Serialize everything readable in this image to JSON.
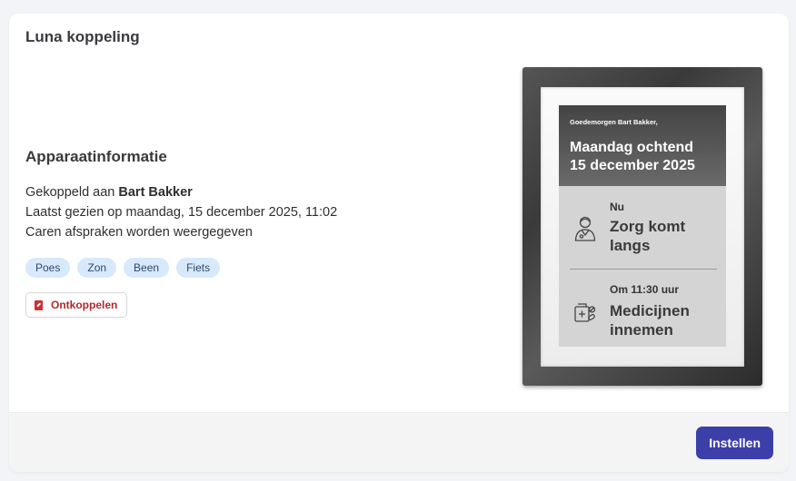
{
  "card": {
    "title": "Luna koppeling"
  },
  "info": {
    "section_title": "Apparaatinformatie",
    "linked_prefix": "Gekoppeld aan ",
    "linked_name": "Bart Bakker",
    "last_seen": "Laatst gezien op maandag, 15 december 2025, 11:02",
    "appointments_note": "Caren afspraken worden weergegeven",
    "tags": [
      "Poes",
      "Zon",
      "Been",
      "Fiets"
    ],
    "unlink_label": "Ontkoppelen"
  },
  "device": {
    "greeting": "Goedemorgen Bart Bakker,",
    "date_line1": "Maandag ochtend",
    "date_line2": "15 december 2025",
    "item1": {
      "sub": "Nu",
      "main": "Zorg komt langs",
      "icon": "caregiver-icon"
    },
    "item2": {
      "sub": "Om 11:30 uur",
      "main": "Medicijnen innemen",
      "icon": "medicine-icon"
    }
  },
  "footer": {
    "primary_label": "Instellen"
  },
  "colors": {
    "primary": "#3c3fa8",
    "danger": "#b0282d",
    "tag_bg": "#d8e9fb"
  }
}
